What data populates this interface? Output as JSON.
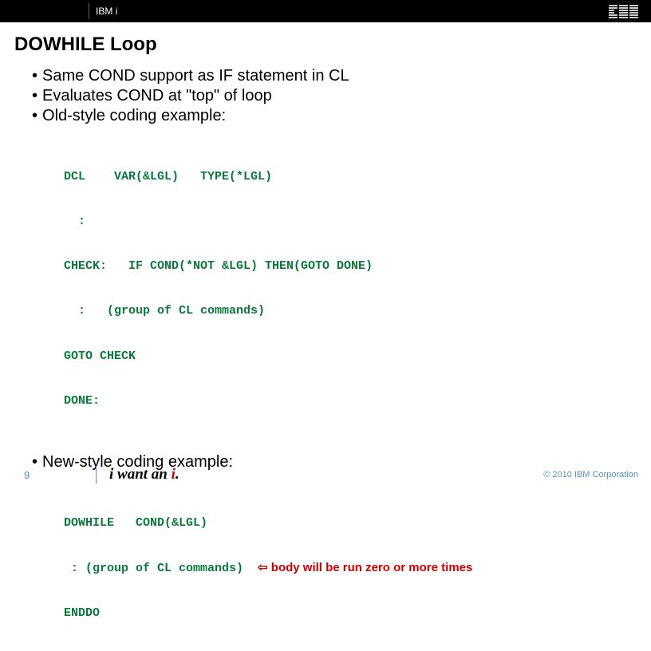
{
  "header": {
    "label": "IBM i",
    "logo_name": "ibm-logo"
  },
  "title": "DOWHILE Loop",
  "bullets": {
    "b1": "Same COND support as IF statement in CL",
    "b2": "Evaluates COND at \"top\" of loop",
    "b3": "Old-style coding example:",
    "b4": "New-style coding example:"
  },
  "code_old": {
    "l1": "DCL    VAR(&LGL)   TYPE(*LGL)",
    "l2": "  :",
    "l3": "CHECK:   IF COND(*NOT &LGL) THEN(GOTO DONE)",
    "l4": "  :   (group of CL commands)",
    "l5": "GOTO CHECK",
    "l6": "DONE:"
  },
  "code_new": {
    "l1": "DOWHILE   COND(&LGL)",
    "l2a": " : (group of CL commands)  ",
    "l2b_arrow": "⇦",
    "l2c_note": " body will be run zero or more times",
    "l3": "ENDDO"
  },
  "footer": {
    "slide_number": "9",
    "tagline_prefix": "i want an ",
    "tagline_i": "i",
    "tagline_suffix": ".",
    "copyright": "© 2010 IBM Corporation"
  }
}
